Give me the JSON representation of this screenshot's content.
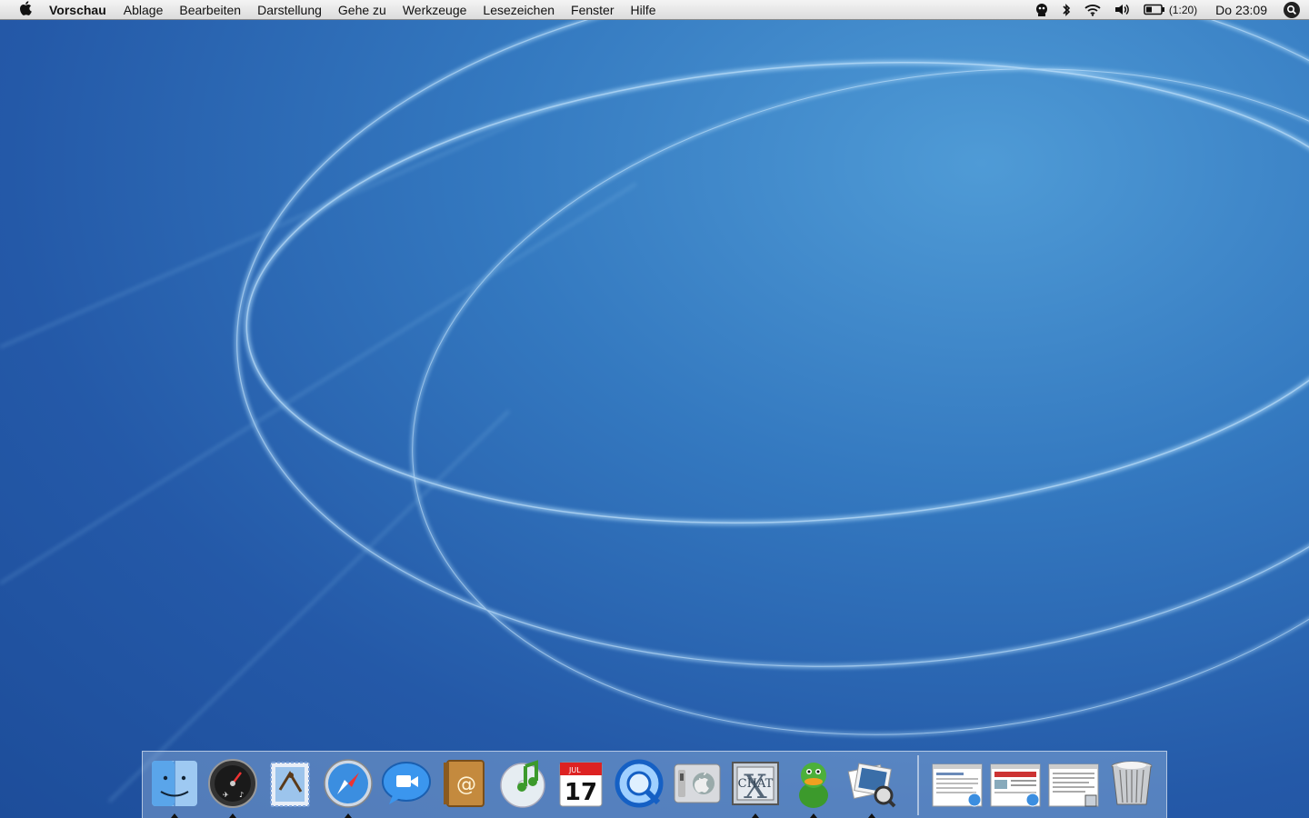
{
  "menubar": {
    "apple_icon": "apple-logo-icon",
    "app_name": "Vorschau",
    "menus": [
      "Ablage",
      "Bearbeiten",
      "Darstellung",
      "Gehe zu",
      "Werkzeuge",
      "Lesezeichen",
      "Fenster",
      "Hilfe"
    ],
    "status": {
      "battery_time": "(1:20)",
      "clock": "Do 23:09"
    }
  },
  "dock": {
    "items": [
      {
        "icon": "finder-icon",
        "running": true
      },
      {
        "icon": "dashboard-icon",
        "running": true
      },
      {
        "icon": "mail-icon",
        "running": false
      },
      {
        "icon": "safari-icon",
        "running": true
      },
      {
        "icon": "ichat-icon",
        "running": false
      },
      {
        "icon": "address-book-icon",
        "running": false
      },
      {
        "icon": "itunes-icon",
        "running": false
      },
      {
        "icon": "ical-icon",
        "running": false
      },
      {
        "icon": "quicktime-icon",
        "running": false
      },
      {
        "icon": "system-preferences-icon",
        "running": false
      },
      {
        "icon": "chat-x-icon",
        "running": true
      },
      {
        "icon": "adium-duck-icon",
        "running": true
      },
      {
        "icon": "preview-icon",
        "running": true
      },
      {
        "icon": "minimized-window-1-icon",
        "running": false
      },
      {
        "icon": "minimized-window-2-icon",
        "running": false
      },
      {
        "icon": "minimized-window-3-icon",
        "running": false
      },
      {
        "icon": "trash-icon",
        "running": false
      }
    ],
    "ical_month": "JUL",
    "ical_day": "17",
    "chat_label": "CHAT"
  },
  "colors": {
    "desktop": "#2a62ae",
    "arc": "#9cd0f5"
  }
}
